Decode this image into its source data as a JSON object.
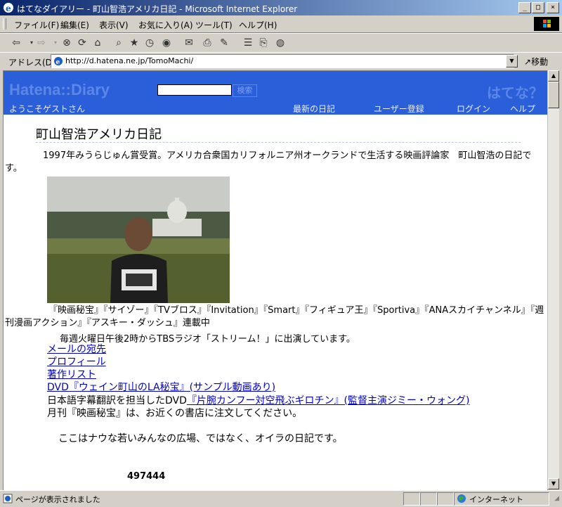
{
  "window": {
    "title": "はてなダイアリー - 町山智浩アメリカ日記 - Microsoft Internet Explorer"
  },
  "menu": [
    "ファイル(F)",
    "編集(E)",
    "表示(V)",
    "お気に入り(A)",
    "ツール(T)",
    "ヘルプ(H)"
  ],
  "toolbar": {
    "icons": [
      "back-icon",
      "forward-icon",
      "stop-icon",
      "refresh-icon",
      "home-icon",
      "search-icon",
      "favorites-icon",
      "history-icon",
      "media-icon",
      "mail-icon",
      "print-icon",
      "edit-icon",
      "discuss-icon",
      "messenger-icon"
    ]
  },
  "address": {
    "label": "アドレス(D)",
    "url": "http://d.hatena.ne.jp/TomoMachi/",
    "go": "移動"
  },
  "hatena": {
    "logo": "Hatena::Diary",
    "search_button": "検索",
    "right_logo": "はてな？",
    "welcome": "ようこそゲストさん",
    "nav": [
      "最新の日記",
      "ユーザー登録",
      "ログイン",
      "ヘルプ"
    ]
  },
  "diary": {
    "title": "町山智浩アメリカ日記",
    "description": "1997年みうらじゅん賞受賞。アメリカ合衆国カリフォルニア州オークランドで生活する映画評論家　町山智浩の日記です。",
    "magazines": "『映画秘宝』『サイゾー』『TVブロス』『Invitation』『Smart』『フィギュア王』『Sportiva』『ANAスカイチャンネル』『週刊漫画アクション』『アスキー・ダッシュ』連載中",
    "radio": "毎週火曜日午後2時からTBSラジオ「ストリーム！」に出演しています。",
    "links": [
      "メールの宛先",
      "プロフィール",
      "著作リスト",
      "DVD『ウェイン町山のLA秘宝』(サンプル動画あり)"
    ],
    "subtitle_prefix": "日本語字幕翻訳を担当したDVD",
    "subtitle_link": "『片腕カンフー対空飛ぶギロチン』(監督主演ジミー・ウォング)",
    "hiho": "月刊『映画秘宝』は、お近くの書店に注文してください。",
    "note": "ここはナウな若いみんなの広場、ではなく、オイラの日記です。",
    "counter": "497444"
  },
  "status": {
    "text": "ページが表示されました",
    "zone": "インターネット"
  }
}
